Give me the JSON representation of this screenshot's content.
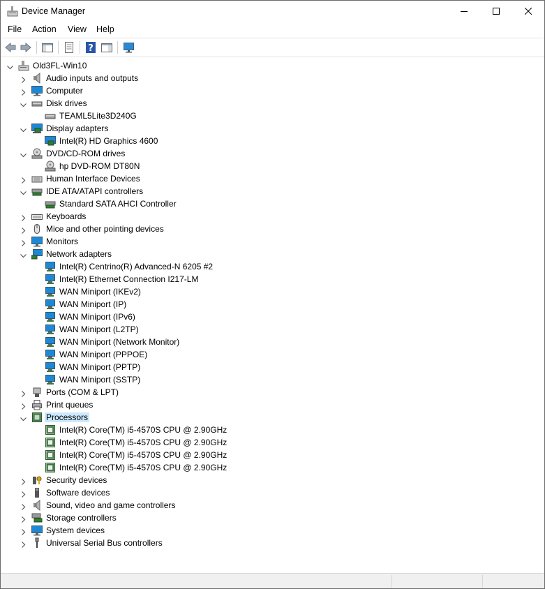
{
  "window": {
    "title": "Device Manager",
    "controls": [
      "minimize-icon",
      "maximize-icon",
      "close-icon"
    ]
  },
  "menu": [
    "File",
    "Action",
    "View",
    "Help"
  ],
  "toolbar": [
    "back-arrow-icon",
    "forward-arrow-icon",
    "show-hide-console-tree-icon",
    "properties-icon",
    "help-icon",
    "action-pane-icon",
    "scan-hardware-icon"
  ],
  "tree": {
    "root": "Old3FL-Win10",
    "categories": [
      {
        "label": "Audio inputs and outputs",
        "icon": "speaker-icon",
        "expanded": false,
        "children": []
      },
      {
        "label": "Computer",
        "icon": "computer-icon",
        "expanded": false,
        "children": []
      },
      {
        "label": "Disk drives",
        "icon": "disk-drive-icon",
        "expanded": true,
        "children": [
          "TEAML5Lite3D240G"
        ]
      },
      {
        "label": "Display adapters",
        "icon": "display-adapter-icon",
        "expanded": true,
        "children": [
          "Intel(R) HD Graphics 4600"
        ]
      },
      {
        "label": "DVD/CD-ROM drives",
        "icon": "dvd-drive-icon",
        "expanded": true,
        "children": [
          "hp DVD-ROM DT80N"
        ]
      },
      {
        "label": "Human Interface Devices",
        "icon": "hid-icon",
        "expanded": false,
        "children": []
      },
      {
        "label": "IDE ATA/ATAPI controllers",
        "icon": "ide-controller-icon",
        "expanded": true,
        "children": [
          "Standard SATA AHCI Controller"
        ]
      },
      {
        "label": "Keyboards",
        "icon": "keyboard-icon",
        "expanded": false,
        "children": []
      },
      {
        "label": "Mice and other pointing devices",
        "icon": "mouse-icon",
        "expanded": false,
        "children": []
      },
      {
        "label": "Monitors",
        "icon": "monitor-icon",
        "expanded": false,
        "children": []
      },
      {
        "label": "Network adapters",
        "icon": "network-adapter-icon",
        "expanded": true,
        "children": [
          "Intel(R) Centrino(R) Advanced-N 6205 #2",
          "Intel(R) Ethernet Connection I217-LM",
          "WAN Miniport (IKEv2)",
          "WAN Miniport (IP)",
          "WAN Miniport (IPv6)",
          "WAN Miniport (L2TP)",
          "WAN Miniport (Network Monitor)",
          "WAN Miniport (PPPOE)",
          "WAN Miniport (PPTP)",
          "WAN Miniport (SSTP)"
        ]
      },
      {
        "label": "Ports (COM & LPT)",
        "icon": "port-icon",
        "expanded": false,
        "children": []
      },
      {
        "label": "Print queues",
        "icon": "printer-icon",
        "expanded": false,
        "children": []
      },
      {
        "label": "Processors",
        "icon": "processor-icon",
        "expanded": true,
        "selected": true,
        "children": [
          "Intel(R) Core(TM) i5-4570S CPU @ 2.90GHz",
          "Intel(R) Core(TM) i5-4570S CPU @ 2.90GHz",
          "Intel(R) Core(TM) i5-4570S CPU @ 2.90GHz",
          "Intel(R) Core(TM) i5-4570S CPU @ 2.90GHz"
        ]
      },
      {
        "label": "Security devices",
        "icon": "security-device-icon",
        "expanded": false,
        "children": []
      },
      {
        "label": "Software devices",
        "icon": "software-device-icon",
        "expanded": false,
        "children": []
      },
      {
        "label": "Sound, video and game controllers",
        "icon": "sound-icon",
        "expanded": false,
        "children": []
      },
      {
        "label": "Storage controllers",
        "icon": "storage-controller-icon",
        "expanded": false,
        "children": []
      },
      {
        "label": "System devices",
        "icon": "system-device-icon",
        "expanded": false,
        "children": []
      },
      {
        "label": "Universal Serial Bus controllers",
        "icon": "usb-icon",
        "expanded": false,
        "children": []
      }
    ]
  },
  "colors": {
    "selection": "#cce8ff",
    "monitor_blue": "#1e88d6",
    "chip_green": "#2f7d32"
  }
}
